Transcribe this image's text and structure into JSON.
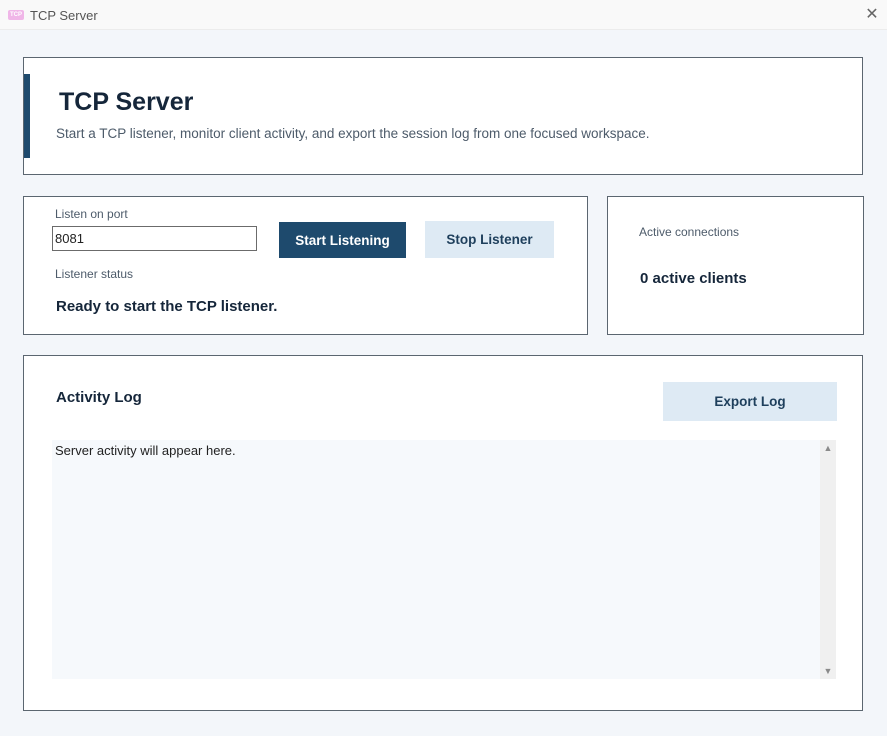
{
  "window": {
    "title": "TCP Server",
    "icon_text": "TCP",
    "close_glyph": "✕"
  },
  "header": {
    "title": "TCP Server",
    "subtitle": "Start a TCP listener, monitor client activity, and export the session log from one focused workspace."
  },
  "controls": {
    "port_label": "Listen on port",
    "port_value": "8081",
    "start_label": "Start Listening",
    "stop_label": "Stop Listener",
    "status_label": "Listener status",
    "status_text": "Ready to start the TCP listener."
  },
  "connections": {
    "label": "Active connections",
    "value": "0 active clients"
  },
  "log": {
    "title": "Activity Log",
    "export_label": "Export Log",
    "content": "Server activity will appear here.",
    "scroll_up_glyph": "▲",
    "scroll_down_glyph": "▼"
  },
  "colors": {
    "accent": "#1e4a6d",
    "secondary_button": "#deeaf4",
    "background": "#f3f6fa"
  }
}
